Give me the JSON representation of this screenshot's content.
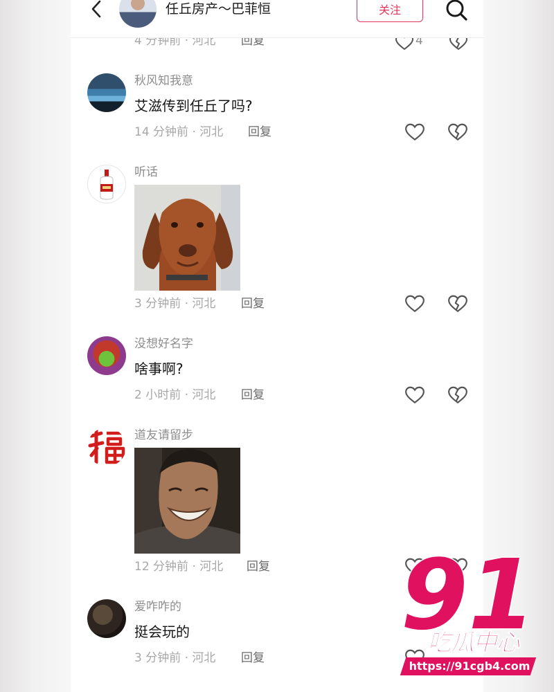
{
  "header": {
    "title": "任丘房产～巴菲恒",
    "follow_label": "关注"
  },
  "previous_comment": {
    "meta": "4 分钟前 · 河北",
    "reply_label": "回复",
    "like_count": "4"
  },
  "comments": [
    {
      "username": "秋风知我意",
      "text": "艾滋传到任丘了吗?",
      "meta": "14 分钟前 · 河北",
      "reply_label": "回复"
    },
    {
      "username": "听话",
      "text": "",
      "meta": "3 分钟前 · 河北",
      "reply_label": "回复",
      "image": "dog-photo"
    },
    {
      "username": "没想好名字",
      "text": "啥事啊?",
      "meta": "2 小时前 · 河北",
      "reply_label": "回复"
    },
    {
      "username": "道友请留步",
      "text": "",
      "meta": "12 分钟前 · 河北",
      "reply_label": "回复",
      "image": "smiling-man-photo"
    },
    {
      "username": "爱咋咋的",
      "text": "挺会玩的",
      "meta": "3 分钟前 · 河北",
      "reply_label": "回复"
    }
  ],
  "icons": {
    "back": "chevron-left-icon",
    "search": "search-icon",
    "like": "heart-icon",
    "dislike": "broken-heart-icon"
  },
  "watermark": {
    "number": "91",
    "subtitle": "吃瓜中心",
    "url": "https://91cgb4.com"
  },
  "colors": {
    "accent": "#e5335a",
    "watermark": "#e0115f",
    "text_primary": "#161616",
    "text_secondary": "#a7a7a7"
  }
}
